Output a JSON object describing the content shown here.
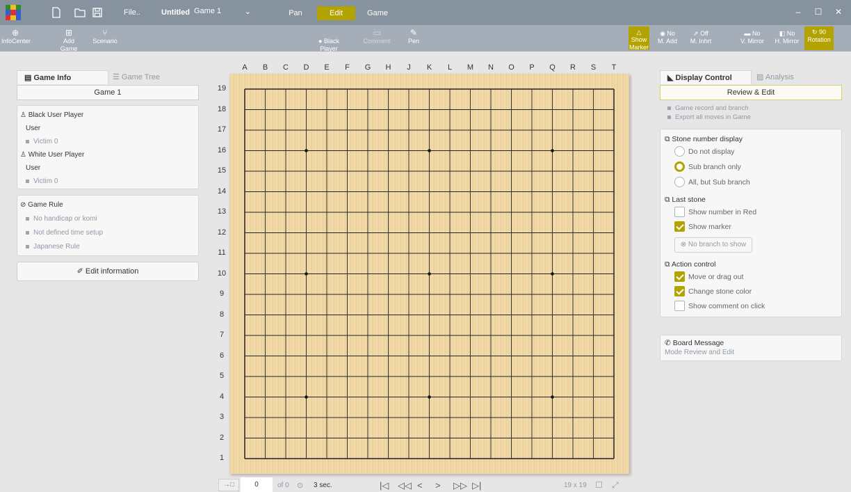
{
  "app": {
    "logo_colors": [
      "#2c8d2c",
      "#f0c020",
      "#2c8d2c",
      "#2f5fd0",
      "#e03030",
      "#2f5fd0",
      "#e03030",
      "#f0c020",
      "#2f5fd0"
    ],
    "accent": "#b3a300"
  },
  "titlebar": {
    "icons": [
      "new-file-icon",
      "open-folder-icon",
      "save-icon"
    ],
    "file_menu": "File..",
    "doc_title": "Untitled",
    "game_select": "Game 1",
    "modes": [
      "Pan",
      "Edit",
      "Game"
    ],
    "active_mode": "Edit"
  },
  "toolbar": {
    "infocenter": "InfoCenter",
    "add_game": "Add Game",
    "scenario": "Scenario",
    "black_player_line1": "Black",
    "black_player_line2": "Player",
    "comment": "Comment",
    "pen": "Pen",
    "show_marker_line1": "Show",
    "show_marker_line2": "Marker",
    "m_add_line1": "No",
    "m_add_line2": "M. Add",
    "m_inhrt_line1": "Off",
    "m_inhrt_line2": "M. Inhrt",
    "v_mirror_line1": "No",
    "v_mirror_line2": "V. Mirror",
    "h_mirror_line1": "No",
    "h_mirror_line2": "H. Mirror",
    "rotation_line1": "90",
    "rotation_line2": "Rotation"
  },
  "left": {
    "tab_game_info": "Game Info",
    "tab_game_tree": "Game Tree",
    "game_name": "Game 1",
    "black_title": "Black User Player",
    "black_name": "User",
    "black_victim": "Victim 0",
    "white_title": "White User Player",
    "white_name": "User",
    "white_victim": "Victim 0",
    "rule_title": "Game Rule",
    "rules": [
      "No handicap or komi",
      "Not defined time setup",
      "Japanese Rule"
    ],
    "edit_button": "Edit information"
  },
  "board": {
    "size": 19,
    "columns": [
      "A",
      "B",
      "C",
      "D",
      "E",
      "F",
      "G",
      "H",
      "J",
      "K",
      "L",
      "M",
      "N",
      "O",
      "P",
      "Q",
      "R",
      "S",
      "T"
    ],
    "rows": [
      "19",
      "18",
      "17",
      "16",
      "15",
      "14",
      "13",
      "12",
      "11",
      "10",
      "9",
      "8",
      "7",
      "6",
      "5",
      "4",
      "3",
      "2",
      "1"
    ]
  },
  "footer": {
    "move": "0",
    "of": "of 0",
    "delay": "3 sec.",
    "board_size": "19 x 19"
  },
  "right": {
    "tab_display": "Display Control",
    "tab_analysis": "Analysis",
    "mode": "Review & Edit",
    "notes": [
      "Game record and branch",
      "Export all moves in Game"
    ],
    "stone_number_title": "Stone number display",
    "stone_number_options": [
      "Do not display",
      "Sub branch only",
      "All, but Sub branch"
    ],
    "stone_number_selected": 1,
    "last_stone_title": "Last stone",
    "show_red": "Show number in Red",
    "show_marker": "Show marker",
    "no_branch": "No branch to show",
    "action_title": "Action control",
    "move_drag": "Move or drag out",
    "change_color": "Change stone color",
    "show_comment": "Show comment on click",
    "board_message_title": "Board Message",
    "board_message": "Mode Review and Edit"
  }
}
